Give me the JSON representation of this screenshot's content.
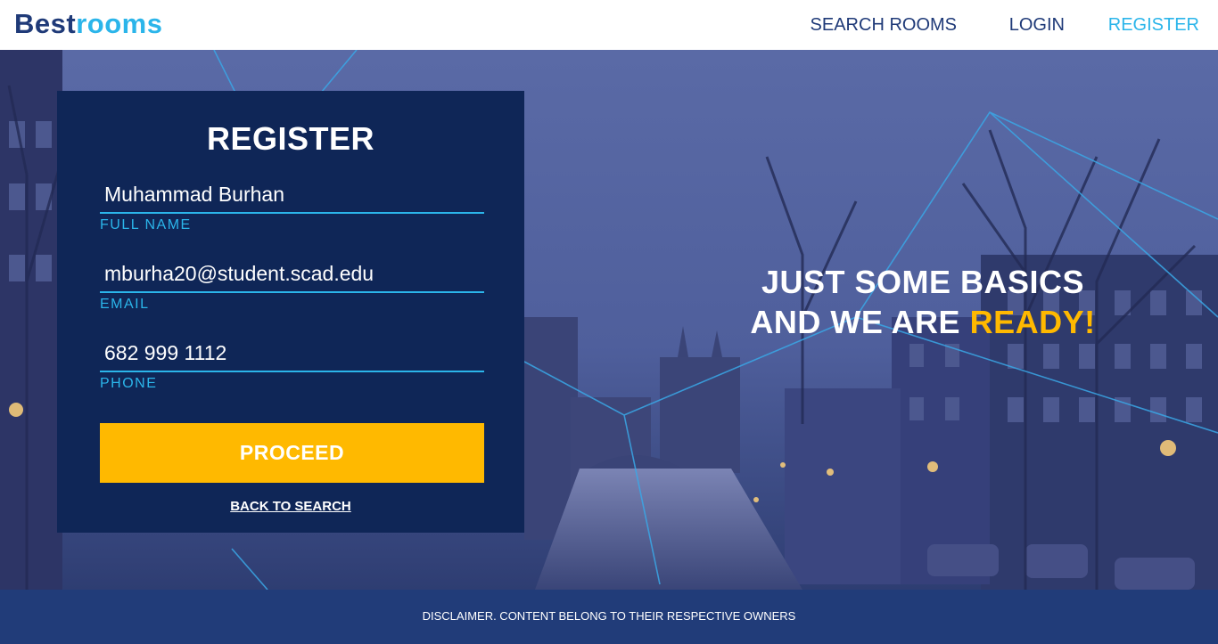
{
  "brand": {
    "name_part1": "Best",
    "name_part2": "rooms"
  },
  "nav": {
    "search_rooms": "SEARCH ROOMS",
    "login": "LOGIN",
    "register": "REGISTER",
    "active": "register"
  },
  "form": {
    "title": "REGISTER",
    "full_name": {
      "value": "Muhammad Burhan",
      "label": "FULL NAME"
    },
    "email": {
      "value": "mburha20@student.scad.edu",
      "label": "EMAIL"
    },
    "phone": {
      "value": "682 999 1112",
      "label": "PHONE"
    },
    "proceed_label": "PROCEED",
    "back_label": "BACK TO SEARCH"
  },
  "tagline": {
    "line1": "JUST SOME BASICS",
    "line2_prefix": "AND WE ARE ",
    "line2_highlight": "READY!"
  },
  "footer": {
    "disclaimer": "DISCLAIMER. CONTENT BELONG TO THEIR RESPECTIVE OWNERS"
  },
  "colors": {
    "navy": "#1f3a78",
    "accent_blue": "#2bb5ea",
    "yellow": "#ffb900",
    "panel": "#0f2657",
    "footer": "#213c79"
  }
}
